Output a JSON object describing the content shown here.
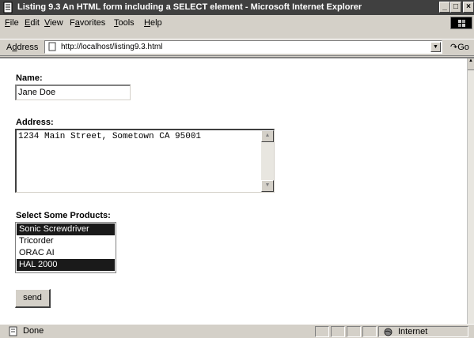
{
  "window": {
    "title": "Listing 9.3 An HTML form including a SELECT element - Microsoft Internet Explorer",
    "controls": {
      "minimize": "_",
      "maximize": "□",
      "close": "×"
    }
  },
  "menu": {
    "items": [
      {
        "key": "F",
        "rest": "ile"
      },
      {
        "key": "E",
        "rest": "dit"
      },
      {
        "key": "V",
        "rest": "iew"
      },
      {
        "key": "a",
        "pre": "F",
        "rest": "vorites"
      },
      {
        "key": "T",
        "rest": "ools"
      },
      {
        "key": "H",
        "rest": "elp"
      }
    ]
  },
  "address": {
    "label_pre": "A",
    "label_key": "d",
    "label_rest": "dress",
    "url": "http://localhost/listing9.3.html",
    "go_label": "Go"
  },
  "form": {
    "name_label": "Name:",
    "name_value": "Jane Doe",
    "address_label": "Address:",
    "address_value": "1234 Main Street, Sometown CA 95001",
    "products_label": "Select Some Products:",
    "products": [
      {
        "label": "Sonic Screwdriver",
        "selected": true
      },
      {
        "label": "Tricorder",
        "selected": false
      },
      {
        "label": "ORAC AI",
        "selected": false
      },
      {
        "label": "HAL 2000",
        "selected": true
      }
    ],
    "send_label": "send"
  },
  "status": {
    "text": "Done",
    "zone": "Internet"
  },
  "colors": {
    "titlebar": "#404040",
    "chrome": "#d4d0c8",
    "selection": "#1a1a1a"
  },
  "icons": [
    "ie-page-icon",
    "windows-logo-icon",
    "go-arrow-icon",
    "page-done-icon",
    "globe-icon"
  ]
}
